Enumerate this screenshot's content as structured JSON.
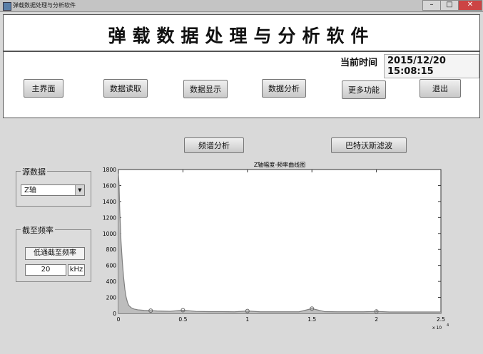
{
  "window": {
    "title": "弹载数据处理与分析软件",
    "controls": [
      "–",
      "□",
      "✕"
    ]
  },
  "header": {
    "app_title": "弹载数据处理与分析软件"
  },
  "status": {
    "time_label": "当前时间",
    "date": "2015/12/20",
    "time": "15:08:15"
  },
  "nav": {
    "main_menu": "主界面",
    "data_read": "数据读取",
    "data_display": "数据显示",
    "data_analysis": "数据分析",
    "more": "更多功能",
    "exit": "退出"
  },
  "actions": {
    "spectrum": "频谱分析",
    "butterworth": "巴特沃斯滤波"
  },
  "source_group": {
    "title": "源数据",
    "selected": "Z轴"
  },
  "cutoff_group": {
    "title": "截至频率",
    "button": "低通截至频率",
    "value": "20",
    "unit": "kHz"
  },
  "chart_data": {
    "type": "line",
    "title": "Z轴幅度-频率曲线图",
    "xlabel": "",
    "ylabel": "",
    "x_multiplier_label": "x 10",
    "x_multiplier_exp": "4",
    "xlim": [
      0,
      2.5
    ],
    "ylim": [
      0,
      1800
    ],
    "xticks": [
      "0",
      "0.5",
      "1",
      "1.5",
      "2",
      "2.5"
    ],
    "yticks": [
      "0",
      "200",
      "400",
      "600",
      "800",
      "1000",
      "1200",
      "1400",
      "1600",
      "1800"
    ],
    "grid": false,
    "series": [
      {
        "color": "#7f7f7f",
        "x": [
          0,
          0.005,
          0.01,
          0.015,
          0.02,
          0.03,
          0.04,
          0.05,
          0.06,
          0.07,
          0.08,
          0.1,
          0.12,
          0.15,
          0.2,
          0.25,
          0.3,
          0.35,
          0.4,
          0.5,
          0.6,
          0.7,
          0.8,
          0.9,
          1.0,
          1.1,
          1.2,
          1.3,
          1.4,
          1.5,
          1.6,
          1.7,
          1.8,
          1.9,
          2.0,
          2.1,
          2.2,
          2.3,
          2.4,
          2.5
        ],
        "y": [
          1750,
          1600,
          1300,
          1100,
          900,
          650,
          450,
          300,
          200,
          140,
          100,
          70,
          55,
          45,
          38,
          35,
          30,
          28,
          26,
          40,
          25,
          22,
          22,
          20,
          30,
          20,
          20,
          20,
          20,
          60,
          22,
          20,
          20,
          20,
          25,
          18,
          18,
          18,
          18,
          18
        ]
      }
    ],
    "markers": [
      {
        "x": 0.25,
        "y": 35
      },
      {
        "x": 0.5,
        "y": 40
      },
      {
        "x": 1.0,
        "y": 30
      },
      {
        "x": 1.5,
        "y": 60
      },
      {
        "x": 2.0,
        "y": 25
      }
    ]
  }
}
